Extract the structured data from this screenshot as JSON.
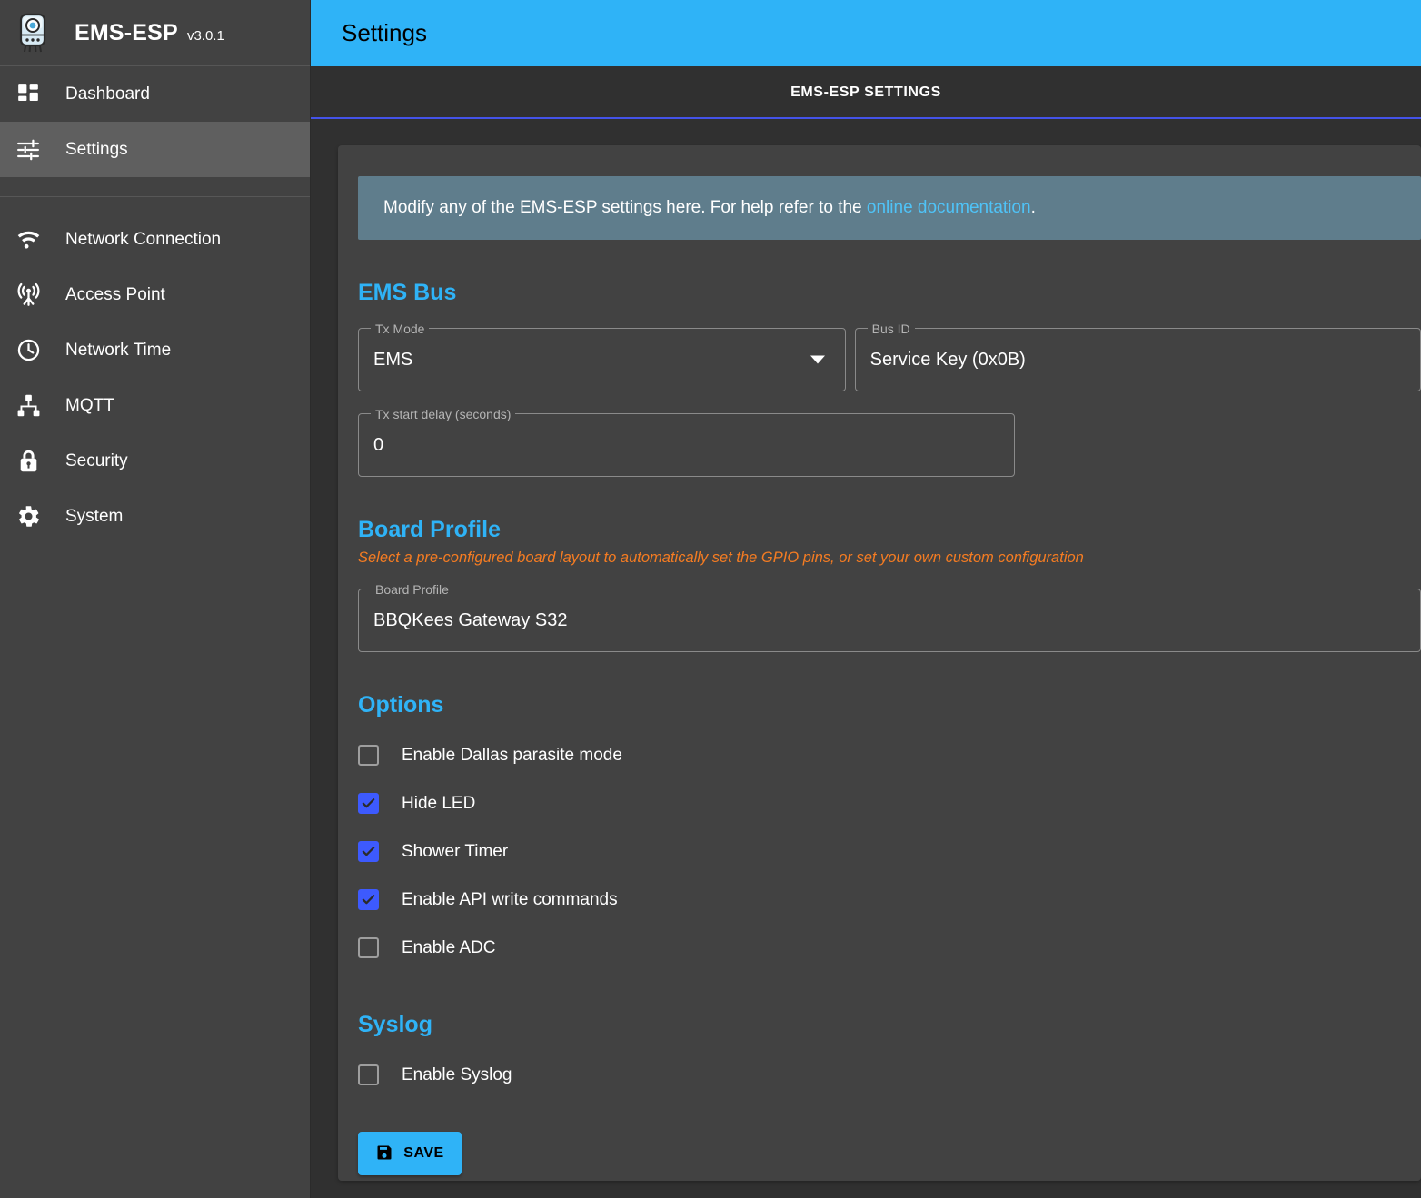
{
  "brand": {
    "title": "EMS-ESP",
    "version": "v3.0.1",
    "logo_icon": "boiler-icon"
  },
  "sidebar": {
    "items": [
      {
        "label": "Dashboard",
        "icon": "dashboard-icon",
        "selected": false
      },
      {
        "label": "Settings",
        "icon": "sliders-icon",
        "selected": true
      },
      {
        "label": "Network Connection",
        "icon": "wifi-icon",
        "selected": false
      },
      {
        "label": "Access Point",
        "icon": "access-point-icon",
        "selected": false
      },
      {
        "label": "Network Time",
        "icon": "clock-icon",
        "selected": false
      },
      {
        "label": "MQTT",
        "icon": "sitemap-icon",
        "selected": false
      },
      {
        "label": "Security",
        "icon": "lock-icon",
        "selected": false
      },
      {
        "label": "System",
        "icon": "gear-icon",
        "selected": false
      }
    ]
  },
  "appbar": {
    "title": "Settings"
  },
  "tabs": [
    {
      "label": "EMS-ESP SETTINGS",
      "selected": true
    }
  ],
  "banner": {
    "text_before": "Modify any of the EMS-ESP settings here. For help refer to the ",
    "link_text": "online documentation",
    "text_after": "."
  },
  "ems_bus": {
    "heading": "EMS Bus",
    "tx_mode": {
      "label": "Tx Mode",
      "value": "EMS"
    },
    "bus_id": {
      "label": "Bus ID",
      "value": "Service Key (0x0B)"
    },
    "tx_delay": {
      "label": "Tx start delay (seconds)",
      "value": "0"
    }
  },
  "board_profile": {
    "heading": "Board Profile",
    "description": "Select a pre-configured board layout to automatically set the GPIO pins, or set your own custom configuration",
    "field": {
      "label": "Board Profile",
      "value": "BBQKees Gateway S32"
    }
  },
  "options": {
    "heading": "Options",
    "items": [
      {
        "label": "Enable Dallas parasite mode",
        "checked": false
      },
      {
        "label": "Hide LED",
        "checked": true
      },
      {
        "label": "Shower Timer",
        "checked": true
      },
      {
        "label": "Enable API write commands",
        "checked": true
      },
      {
        "label": "Enable ADC",
        "checked": false
      }
    ]
  },
  "syslog": {
    "heading": "Syslog",
    "items": [
      {
        "label": "Enable Syslog",
        "checked": false
      }
    ]
  },
  "save_button": {
    "label": "SAVE",
    "icon": "floppy-disk-icon"
  },
  "colors": {
    "accent": "#2fb3f7",
    "checkbox_checked": "#3d5afe",
    "tab_indicator": "#4453e8",
    "warning_text": "#f57c22",
    "banner_bg": "#5f7d8c",
    "link": "#4fc3f7",
    "sidebar_bg": "#424242",
    "page_bg": "#303030",
    "paper_bg": "#424242"
  }
}
